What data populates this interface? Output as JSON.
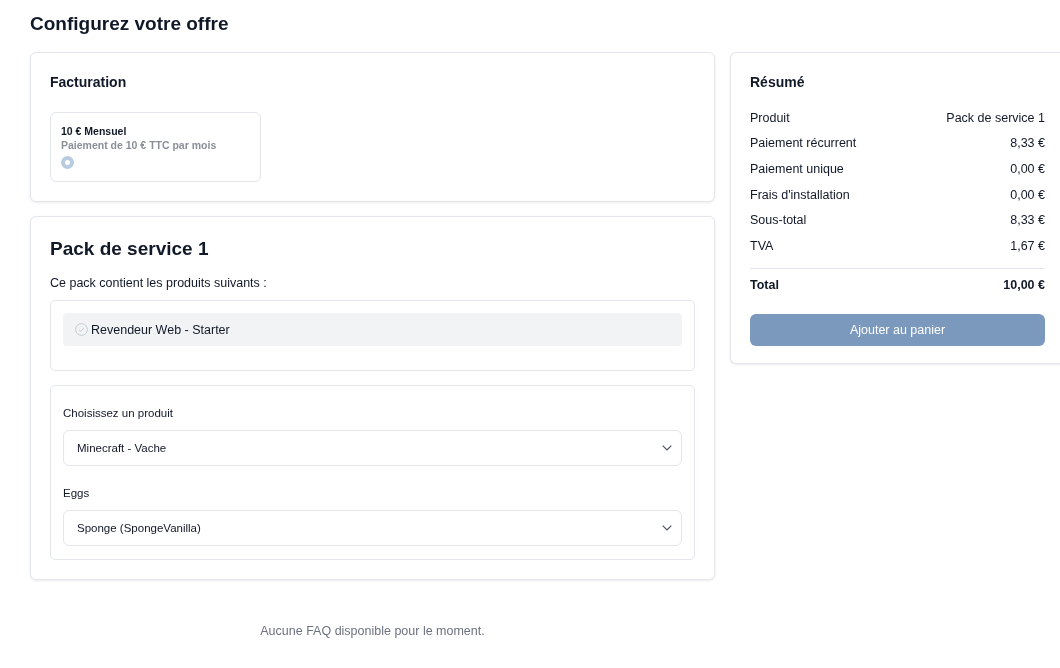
{
  "page_title": "Configurez votre offre",
  "billing": {
    "title": "Facturation",
    "options": [
      {
        "name": "10 € Mensuel",
        "description": "Paiement de 10 € TTC par mois",
        "selected": true
      }
    ]
  },
  "pack": {
    "title": "Pack de service 1",
    "intro": "Ce pack contient les produits suivants :",
    "products": [
      {
        "name": "Revendeur Web - Starter"
      }
    ],
    "fields": [
      {
        "label": "Choisissez un produit",
        "value": "Minecraft - Vache"
      },
      {
        "label": "Eggs",
        "value": "Sponge (SpongeVanilla)"
      }
    ]
  },
  "summary": {
    "title": "Résumé",
    "rows": [
      {
        "label": "Produit",
        "value": "Pack de service 1"
      },
      {
        "label": "Paiement récurrent",
        "value": "8,33 €"
      },
      {
        "label": "Paiement unique",
        "value": "0,00 €"
      },
      {
        "label": "Frais d'installation",
        "value": "0,00 €"
      },
      {
        "label": "Sous-total",
        "value": "8,33 €"
      },
      {
        "label": "TVA",
        "value": "1,67 €"
      }
    ],
    "total": {
      "label": "Total",
      "value": "10,00 €"
    },
    "button": {
      "label": "Ajouter au panier",
      "disabled": true
    }
  },
  "faq_message": "Aucune FAQ disponible pour le moment."
}
